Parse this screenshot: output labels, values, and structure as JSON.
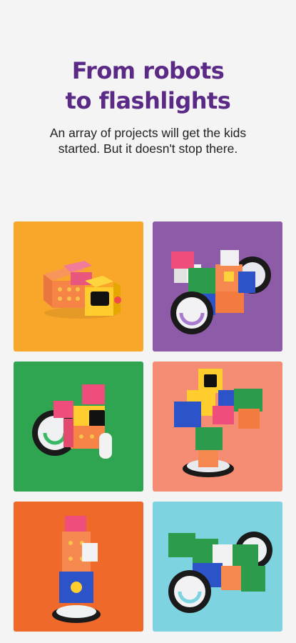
{
  "hero": {
    "title_line1": "From robots",
    "title_line2": "to flashlights",
    "subtitle": "An array of projects will get the kids started. But it doesn't stop there."
  },
  "colors": {
    "title": "#5b2a86",
    "tile_orange": "#f9a72b",
    "tile_purple": "#8d5ba7",
    "tile_green": "#2fa552",
    "tile_salmon": "#f58c74",
    "tile_deep_orange": "#ef6a2a",
    "tile_sky": "#7ed3e0"
  },
  "gallery": {
    "tiles": [
      {
        "icon": "flashlight-robot-icon"
      },
      {
        "icon": "wheeled-robot-icon"
      },
      {
        "icon": "vehicle-robot-icon"
      },
      {
        "icon": "humanoid-robot-icon"
      },
      {
        "icon": "tower-robot-icon"
      },
      {
        "icon": "car-robot-icon"
      }
    ]
  }
}
